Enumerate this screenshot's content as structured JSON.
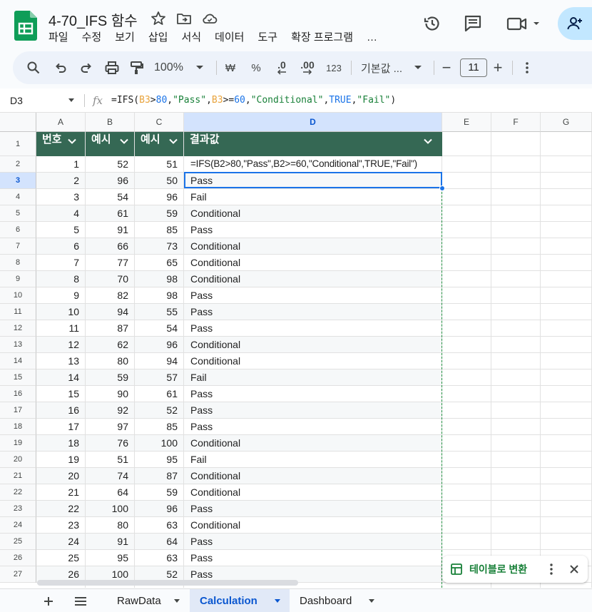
{
  "document": {
    "title": "4-70_IFS 함수",
    "menu": [
      "파일",
      "수정",
      "보기",
      "삽입",
      "서식",
      "데이터",
      "도구",
      "확장 프로그램",
      "…"
    ]
  },
  "toolbar": {
    "zoom": "100%",
    "currency": "₩",
    "percent": "%",
    "decrease_decimal": ".0",
    "increase_decimal": ".00",
    "number_format": "123",
    "font": "기본값 ...",
    "font_size": "11",
    "minus": "−",
    "plus": "+"
  },
  "formula_bar": {
    "cell_ref": "D3",
    "fx": "fx",
    "formula_parts": [
      {
        "t": "=IFS(",
        "c": "plain"
      },
      {
        "t": "B3",
        "c": "ref"
      },
      {
        "t": ">",
        "c": "plain"
      },
      {
        "t": "80",
        "c": "num"
      },
      {
        "t": ",",
        "c": "plain"
      },
      {
        "t": "\"Pass\"",
        "c": "str"
      },
      {
        "t": ",",
        "c": "plain"
      },
      {
        "t": "B3",
        "c": "ref"
      },
      {
        "t": ">=",
        "c": "plain"
      },
      {
        "t": "60",
        "c": "num"
      },
      {
        "t": ",",
        "c": "plain"
      },
      {
        "t": "\"Conditional\"",
        "c": "str"
      },
      {
        "t": ",",
        "c": "plain"
      },
      {
        "t": "TRUE",
        "c": "kw"
      },
      {
        "t": ",",
        "c": "plain"
      },
      {
        "t": "\"Fail\"",
        "c": "str"
      },
      {
        "t": ")",
        "c": "plain"
      }
    ]
  },
  "grid": {
    "columns": [
      "A",
      "B",
      "C",
      "D",
      "E",
      "F",
      "G"
    ],
    "selected_column": "D",
    "selected_row": 3,
    "header_row": {
      "a": "번호",
      "b": "예시",
      "c": "예시",
      "d": "결과값"
    },
    "row_numbers": [
      1,
      2,
      3,
      4,
      5,
      6,
      7,
      8,
      9,
      10,
      11,
      12,
      13,
      14,
      15,
      16,
      17,
      18,
      19,
      20,
      21,
      22,
      23,
      24,
      25,
      26,
      27
    ],
    "rows": [
      {
        "a": "1",
        "b": "52",
        "c": "51",
        "d": "=IFS(B2>80,\"Pass\",B2>=60,\"Conditional\",TRUE,\"Fail\")"
      },
      {
        "a": "2",
        "b": "96",
        "c": "50",
        "d": "Pass"
      },
      {
        "a": "3",
        "b": "54",
        "c": "96",
        "d": "Fail"
      },
      {
        "a": "4",
        "b": "61",
        "c": "59",
        "d": "Conditional"
      },
      {
        "a": "5",
        "b": "91",
        "c": "85",
        "d": "Pass"
      },
      {
        "a": "6",
        "b": "66",
        "c": "73",
        "d": "Conditional"
      },
      {
        "a": "7",
        "b": "77",
        "c": "65",
        "d": "Conditional"
      },
      {
        "a": "8",
        "b": "70",
        "c": "98",
        "d": "Conditional"
      },
      {
        "a": "9",
        "b": "82",
        "c": "98",
        "d": "Pass"
      },
      {
        "a": "10",
        "b": "94",
        "c": "55",
        "d": "Pass"
      },
      {
        "a": "11",
        "b": "87",
        "c": "54",
        "d": "Pass"
      },
      {
        "a": "12",
        "b": "62",
        "c": "96",
        "d": "Conditional"
      },
      {
        "a": "13",
        "b": "80",
        "c": "94",
        "d": "Conditional"
      },
      {
        "a": "14",
        "b": "59",
        "c": "57",
        "d": "Fail"
      },
      {
        "a": "15",
        "b": "90",
        "c": "61",
        "d": "Pass"
      },
      {
        "a": "16",
        "b": "92",
        "c": "52",
        "d": "Pass"
      },
      {
        "a": "17",
        "b": "97",
        "c": "85",
        "d": "Pass"
      },
      {
        "a": "18",
        "b": "76",
        "c": "100",
        "d": "Conditional"
      },
      {
        "a": "19",
        "b": "51",
        "c": "95",
        "d": "Fail"
      },
      {
        "a": "20",
        "b": "74",
        "c": "87",
        "d": "Conditional"
      },
      {
        "a": "21",
        "b": "64",
        "c": "59",
        "d": "Conditional"
      },
      {
        "a": "22",
        "b": "100",
        "c": "96",
        "d": "Pass"
      },
      {
        "a": "23",
        "b": "80",
        "c": "63",
        "d": "Conditional"
      },
      {
        "a": "24",
        "b": "91",
        "c": "64",
        "d": "Pass"
      },
      {
        "a": "25",
        "b": "95",
        "c": "63",
        "d": "Pass"
      },
      {
        "a": "26",
        "b": "100",
        "c": "52",
        "d": "Pass"
      }
    ]
  },
  "convert_chip": {
    "label": "테이블로 변환"
  },
  "sheets": {
    "tabs": [
      "RawData",
      "Calculation",
      "Dashboard"
    ],
    "active": "Calculation"
  },
  "colors": {
    "header_fill": "#356854",
    "accent": "#1a73e8",
    "active_tab": "#0b57d0",
    "band": "#f6f8f9"
  }
}
